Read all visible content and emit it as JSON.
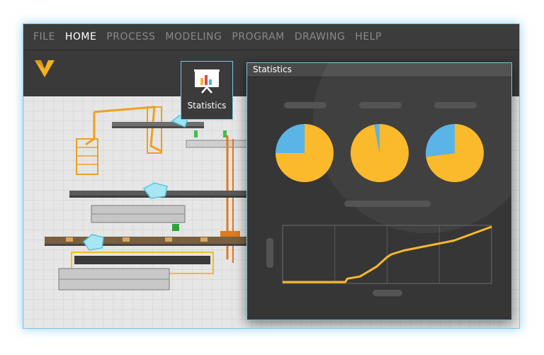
{
  "menu": {
    "items": [
      {
        "label": "FILE",
        "active": false
      },
      {
        "label": "HOME",
        "active": true
      },
      {
        "label": "PROCESS",
        "active": false
      },
      {
        "label": "MODELING",
        "active": false
      },
      {
        "label": "PROGRAM",
        "active": false
      },
      {
        "label": "DRAWING",
        "active": false
      },
      {
        "label": "HELP",
        "active": false
      }
    ]
  },
  "ribbon": {
    "statistics_tool_label": "Statistics"
  },
  "stats_window": {
    "title": "Statistics"
  },
  "colors": {
    "accent_yellow": "#fbb92c",
    "accent_blue": "#5bb4e6",
    "panel_border": "#7fc3df"
  },
  "chart_data": [
    {
      "type": "pie",
      "slices": [
        {
          "name": "",
          "value": 75,
          "color": "#fbb92c"
        },
        {
          "name": "",
          "value": 25,
          "color": "#5bb4e6"
        }
      ]
    },
    {
      "type": "pie",
      "slices": [
        {
          "name": "",
          "value": 97,
          "color": "#fbb92c"
        },
        {
          "name": "",
          "value": 3,
          "color": "#5bb4e6"
        }
      ]
    },
    {
      "type": "pie",
      "slices": [
        {
          "name": "",
          "value": 73,
          "color": "#fbb92c"
        },
        {
          "name": "",
          "value": 27,
          "color": "#5bb4e6"
        }
      ]
    },
    {
      "type": "line",
      "x": [
        0,
        20,
        30,
        31,
        37,
        45,
        50,
        52,
        58,
        70,
        82,
        100
      ],
      "y": [
        0,
        0,
        0,
        6,
        10,
        28,
        45,
        50,
        57,
        66,
        75,
        100
      ],
      "xlim": [
        0,
        100
      ],
      "ylim": [
        0,
        100
      ],
      "grid": true,
      "color": "#fbb92c"
    }
  ]
}
